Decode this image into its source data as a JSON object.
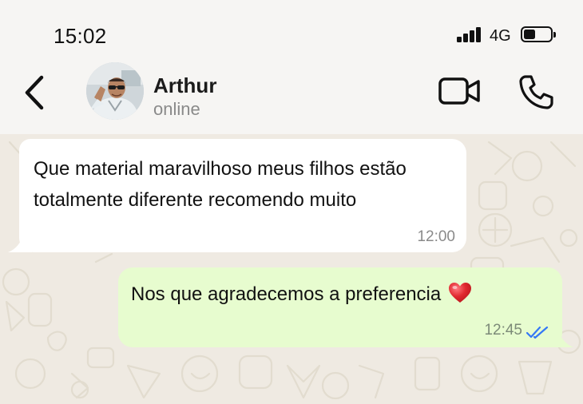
{
  "status_bar": {
    "time": "15:02",
    "network": "4G",
    "signal_bars": 4,
    "battery_level": 0.4
  },
  "header": {
    "back_icon": "chevron-left-icon",
    "contact_name": "Arthur",
    "contact_status": "online",
    "video_call_icon": "video-camera-icon",
    "voice_call_icon": "phone-icon"
  },
  "messages": [
    {
      "direction": "incoming",
      "text": "Que material maravilhoso meus filhos estão totalmente diferente recomendo muito",
      "time": "12:00"
    },
    {
      "direction": "outgoing",
      "text": "Nos que agradecemos a preferencia",
      "emoji": "heart-icon",
      "time": "12:45",
      "status_icon": "double-check-icon",
      "status_color": "#3478f6"
    }
  ],
  "colors": {
    "chat_background": "#efeae2",
    "incoming_bubble": "#ffffff",
    "outgoing_bubble": "#e7fccf",
    "heart": "#e0282f"
  }
}
